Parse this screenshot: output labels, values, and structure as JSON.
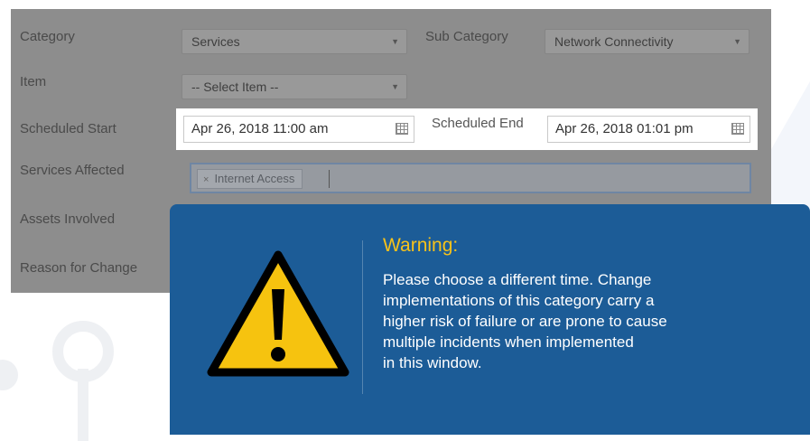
{
  "form": {
    "category": {
      "label": "Category",
      "value": "Services"
    },
    "sub_category": {
      "label": "Sub Category",
      "value": "Network Connectivity"
    },
    "item": {
      "label": "Item",
      "value": "-- Select Item --"
    },
    "scheduled_start": {
      "label": "Scheduled Start",
      "value": "Apr 26, 2018 11:00 am"
    },
    "scheduled_end": {
      "label": "Scheduled End",
      "value": "Apr 26, 2018 01:01 pm"
    },
    "services_affected": {
      "label": "Services Affected",
      "tag": "Internet Access",
      "tag_remove": "×"
    },
    "assets_involved": {
      "label": "Assets Involved"
    },
    "reason_for_change": {
      "label": "Reason for Change"
    }
  },
  "warning": {
    "title": "Warning:",
    "lines": [
      "Please choose a different time. Change",
      "implementations of this category carry a",
      "higher risk of failure or are prone to cause",
      "multiple incidents when implemented",
      "in this window."
    ],
    "icon": "warning-triangle-icon"
  },
  "colors": {
    "warning_bg": "#1c5c97",
    "warning_title": "#f7c21a",
    "warning_icon": "#f6c30f"
  }
}
